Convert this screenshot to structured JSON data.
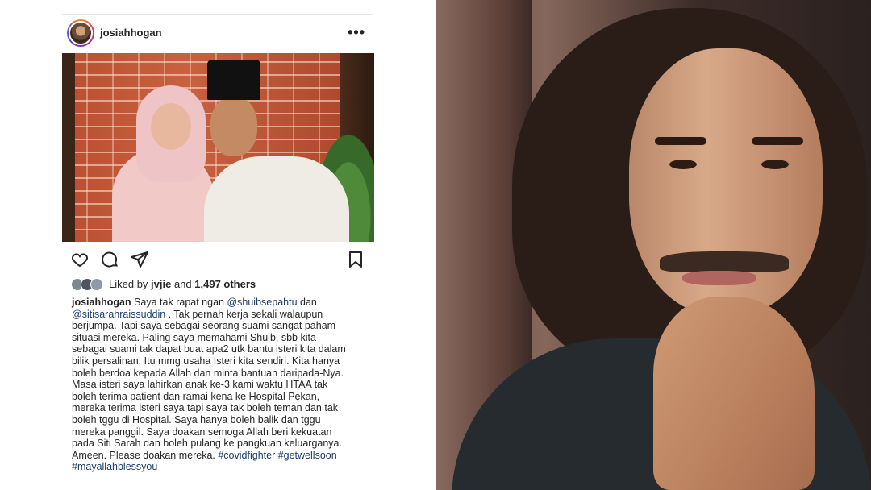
{
  "post": {
    "username": "josiahhogan",
    "more_icon": "more-horizontal-icon",
    "likes": {
      "prefix": "Liked by ",
      "liker": "jvjie",
      "middle": " and ",
      "count": "1,497 others"
    },
    "caption": {
      "user": "josiahhogan",
      "lines": [
        {
          "pre": " Saya tak rapat ngan ",
          "link": "@shuibsepahtu",
          "post": " dan"
        },
        {
          "pre": "",
          "link": "@sitisarahraissuddin",
          "post": " . Tak pernah kerja sekali walaupun"
        },
        {
          "pre": "berjumpa. Tapi saya sebagai seorang suami sangat paham",
          "link": "",
          "post": ""
        },
        {
          "pre": "situasi mereka. Paling saya memahami Shuib, sbb kita",
          "link": "",
          "post": ""
        },
        {
          "pre": "sebagai suami tak dapat buat apa2 utk bantu isteri kita dalam",
          "link": "",
          "post": ""
        },
        {
          "pre": "bilik persalinan. Itu mmg usaha Isteri kita sendiri. Kita hanya",
          "link": "",
          "post": ""
        },
        {
          "pre": "boleh berdoa kepada Allah dan minta bantuan daripada-Nya.",
          "link": "",
          "post": ""
        },
        {
          "pre": "Masa isteri saya lahirkan anak ke-3 kami waktu HTAA tak",
          "link": "",
          "post": ""
        },
        {
          "pre": "boleh terima patient dan ramai kena ke Hospital Pekan,",
          "link": "",
          "post": ""
        },
        {
          "pre": "mereka terima isteri saya tapi saya tak boleh teman dan tak",
          "link": "",
          "post": ""
        },
        {
          "pre": "boleh tggu di Hospital. Saya hanya boleh balik dan tggu",
          "link": "",
          "post": ""
        },
        {
          "pre": "mereka panggil. Saya doakan semoga Allah beri kekuatan",
          "link": "",
          "post": ""
        },
        {
          "pre": "pada Siti Sarah dan boleh pulang ke pangkuan keluarganya.",
          "link": "",
          "post": ""
        },
        {
          "pre": "Ameen. Please doakan mereka. ",
          "link": "#covidfighter #getwellsoon",
          "post": ""
        },
        {
          "pre": "",
          "link": "#mayallahblessyou",
          "post": ""
        }
      ]
    },
    "action_icons": [
      "heart-icon",
      "comment-icon",
      "share-icon",
      "bookmark-icon"
    ],
    "colors": {
      "link": "#1c3d6e",
      "text": "#262626"
    }
  }
}
